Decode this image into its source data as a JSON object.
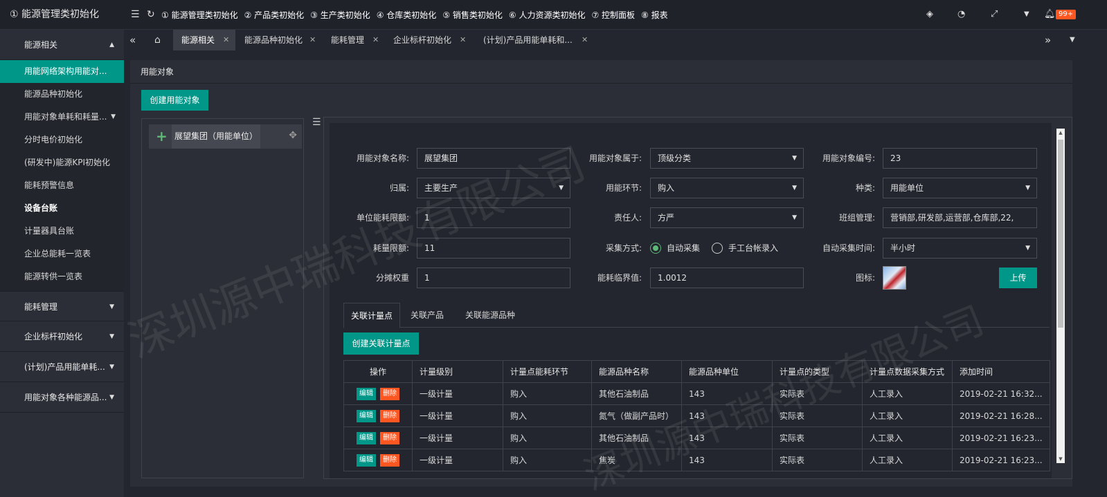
{
  "brand": {
    "title": "① 能源管理类初始化"
  },
  "topmenu": [
    "① 能源管理类初始化",
    "② 产品类初始化",
    "③ 生产类初始化",
    "④ 仓库类初始化",
    "⑤ 销售类初始化",
    "⑥ 人力资源类初始化",
    "⑦ 控制面板",
    "⑧ 报表"
  ],
  "notifications": {
    "badge": "99+"
  },
  "sidebar": {
    "group_energy": "能源相关",
    "items": [
      "用能网络架构用能对...",
      "能源品种初始化",
      "用能对象单耗和耗量...",
      "分时电价初始化",
      "(研发中)能源KPI初始化",
      "能耗预警信息",
      "设备台账",
      "计量器具台账",
      "企业总能耗一览表",
      "能源转供一览表"
    ],
    "groups": [
      "能耗管理",
      "企业标杆初始化",
      "(计划)产品用能单耗...",
      "用能对象各种能源品..."
    ]
  },
  "tabs": [
    {
      "label": "能源相关"
    },
    {
      "label": "能源品种初始化"
    },
    {
      "label": "能耗管理"
    },
    {
      "label": "企业标杆初始化"
    },
    {
      "label": "(计划)产品用能单耗和..."
    }
  ],
  "page": {
    "title": "用能对象",
    "create_button": "创建用能对象"
  },
  "tree": {
    "node": "展望集团（用能单位）"
  },
  "form": {
    "name_label": "用能对象名称:",
    "name_value": "展望集团",
    "belong_label": "用能对象属于:",
    "belong_value": "顶级分类",
    "code_label": "用能对象编号:",
    "code_value": "23",
    "owner_label": "归属:",
    "owner_value": "主要生产",
    "stage_label": "用能环节:",
    "stage_value": "购入",
    "kind_label": "种类:",
    "kind_value": "用能单位",
    "unit_limit_label": "单位能耗限额:",
    "unit_limit_value": "1",
    "person_label": "责任人:",
    "person_value": "方严",
    "team_label": "班组管理:",
    "team_value": "营销部,研发部,运营部,仓库部,22,",
    "qty_limit_label": "耗量限额:",
    "qty_limit_value": "11",
    "collect_label": "采集方式:",
    "collect_auto": "自动采集",
    "collect_manual": "手工台帐录入",
    "auto_time_label": "自动采集时间:",
    "auto_time_value": "半小时",
    "weight_label": "分摊权重",
    "weight_value": "1",
    "critical_label": "能耗临界值:",
    "critical_value": "1.0012",
    "icon_label": "图标:",
    "upload_button": "上传"
  },
  "subtabs": [
    "关联计量点",
    "关联产品",
    "关联能源品种"
  ],
  "create_point_button": "创建关联计量点",
  "table": {
    "headers": [
      "操作",
      "计量级别",
      "计量点能耗环节",
      "能源品种名称",
      "能源品种单位",
      "计量点的类型",
      "计量点数据采集方式",
      "添加时间"
    ],
    "edit_label": "编辑",
    "delete_label": "删除",
    "rows": [
      [
        "一级计量",
        "购入",
        "其他石油制品",
        "143",
        "实际表",
        "人工录入",
        "2019-02-21 16:32..."
      ],
      [
        "一级计量",
        "购入",
        "氮气（做副产品时）",
        "143",
        "实际表",
        "人工录入",
        "2019-02-21 16:28..."
      ],
      [
        "一级计量",
        "购入",
        "其他石油制品",
        "143",
        "实际表",
        "人工录入",
        "2019-02-21 16:23..."
      ],
      [
        "一级计量",
        "购入",
        "焦炭",
        "143",
        "实际表",
        "人工录入",
        "2019-02-21 16:23..."
      ]
    ]
  },
  "watermark": "深圳源中瑞科技有限公司",
  "colors": {
    "accent": "#009688",
    "danger": "#ff5722",
    "radio_on": "#5fb878"
  },
  "icons": [
    "menu-fold-icon",
    "refresh-icon",
    "cube-icon",
    "dashboard-icon",
    "fullscreen-icon",
    "dropdown-icon",
    "bell-icon",
    "home-icon",
    "double-left-icon",
    "double-right-icon",
    "plus-icon",
    "move-icon",
    "indent-icon"
  ]
}
